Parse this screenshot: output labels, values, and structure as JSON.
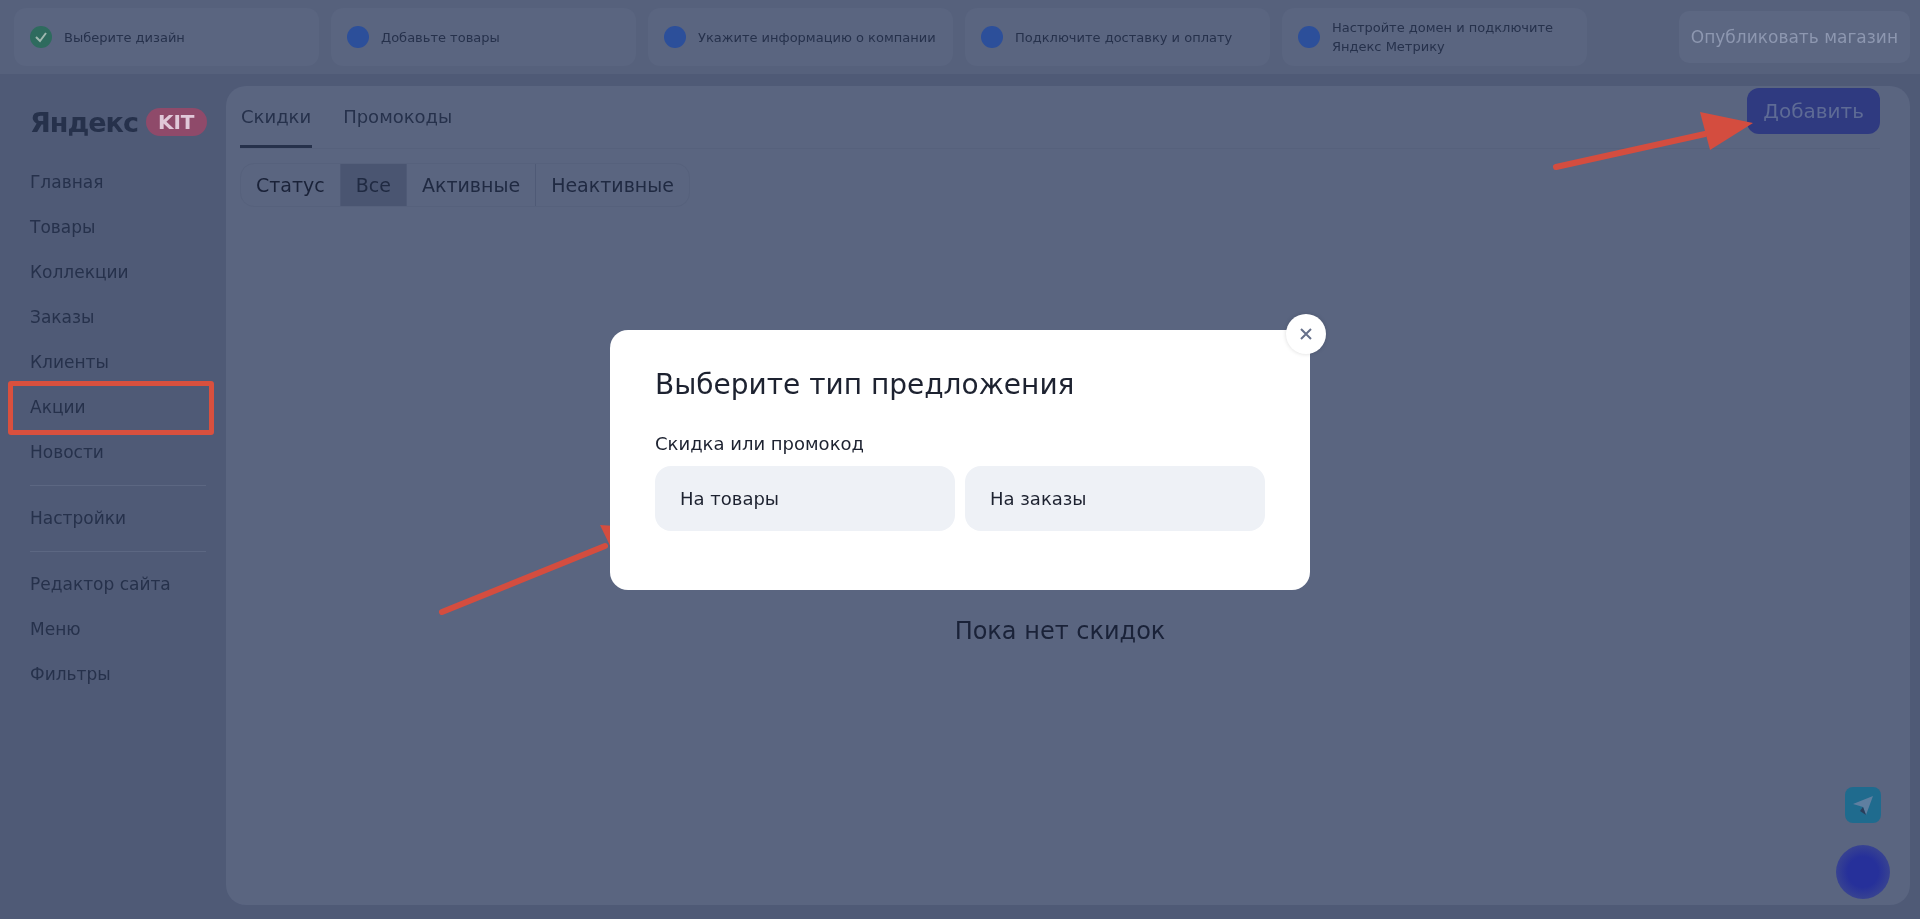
{
  "steps": [
    {
      "label": "Выберите дизайн",
      "done": true
    },
    {
      "label": "Добавьте товары",
      "done": false
    },
    {
      "label": "Укажите информацию о компании",
      "done": false
    },
    {
      "label": "Подключите доставку и оплату",
      "done": false
    },
    {
      "label": "Настройте домен и подключите Яндекс Метрику",
      "done": false
    }
  ],
  "publish_button": {
    "label": "Опубликовать магазин",
    "disabled": true
  },
  "logo": {
    "brand": "Яндекс",
    "badge": "KIT"
  },
  "sidebar": {
    "groups": [
      [
        {
          "label": "Главная",
          "annotated": false
        },
        {
          "label": "Товары",
          "annotated": false
        },
        {
          "label": "Коллекции",
          "annotated": false
        },
        {
          "label": "Заказы",
          "annotated": false
        },
        {
          "label": "Клиенты",
          "annotated": false
        },
        {
          "label": "Акции",
          "annotated": true
        },
        {
          "label": "Новости",
          "annotated": false
        }
      ],
      [
        {
          "label": "Настройки",
          "annotated": false
        }
      ],
      [
        {
          "label": "Редактор сайта",
          "annotated": false
        },
        {
          "label": "Меню",
          "annotated": false
        },
        {
          "label": "Фильтры",
          "annotated": false
        }
      ]
    ]
  },
  "tabs": [
    {
      "label": "Скидки",
      "selected": true
    },
    {
      "label": "Промокоды",
      "selected": false
    }
  ],
  "add_button": {
    "label": "Добавить"
  },
  "filter": {
    "label": "Статус",
    "options": [
      {
        "label": "Все",
        "selected": true
      },
      {
        "label": "Активные",
        "selected": false
      },
      {
        "label": "Неактивные",
        "selected": false
      }
    ]
  },
  "empty_state": {
    "text": "Пока нет скидок"
  },
  "modal": {
    "title": "Выберите тип предложения",
    "subtitle": "Скидка или промокод",
    "options": [
      {
        "label": "На товары"
      },
      {
        "label": "На заказы"
      }
    ]
  }
}
